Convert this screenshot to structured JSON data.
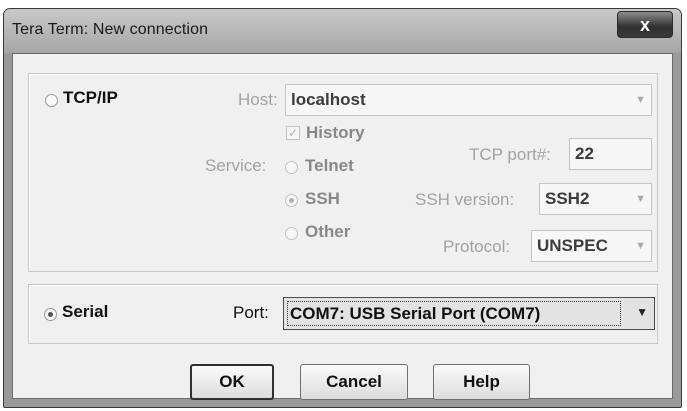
{
  "window": {
    "title": "Tera Term: New connection",
    "close_glyph": "x"
  },
  "tcpip": {
    "label": "TCP/IP",
    "selected": false,
    "host_label": "Host:",
    "host_value": "localhost",
    "history_label": "History",
    "history_checked": true,
    "service_label": "Service:",
    "services": [
      {
        "label": "Telnet",
        "selected": false
      },
      {
        "label": "SSH",
        "selected": true
      },
      {
        "label": "Other",
        "selected": false
      }
    ],
    "tcp_port_label": "TCP port#:",
    "tcp_port_value": "22",
    "ssh_version_label": "SSH version:",
    "ssh_version_value": "SSH2",
    "protocol_label": "Protocol:",
    "protocol_value": "UNSPEC"
  },
  "serial": {
    "label": "Serial",
    "selected": true,
    "port_label": "Port:",
    "port_value": "COM7: USB Serial Port (COM7)"
  },
  "buttons": {
    "ok": "OK",
    "cancel": "Cancel",
    "help": "Help"
  },
  "icons": {
    "combo_arrow": "chevron-down-icon",
    "check": "checkmark-icon",
    "close": "close-icon"
  }
}
